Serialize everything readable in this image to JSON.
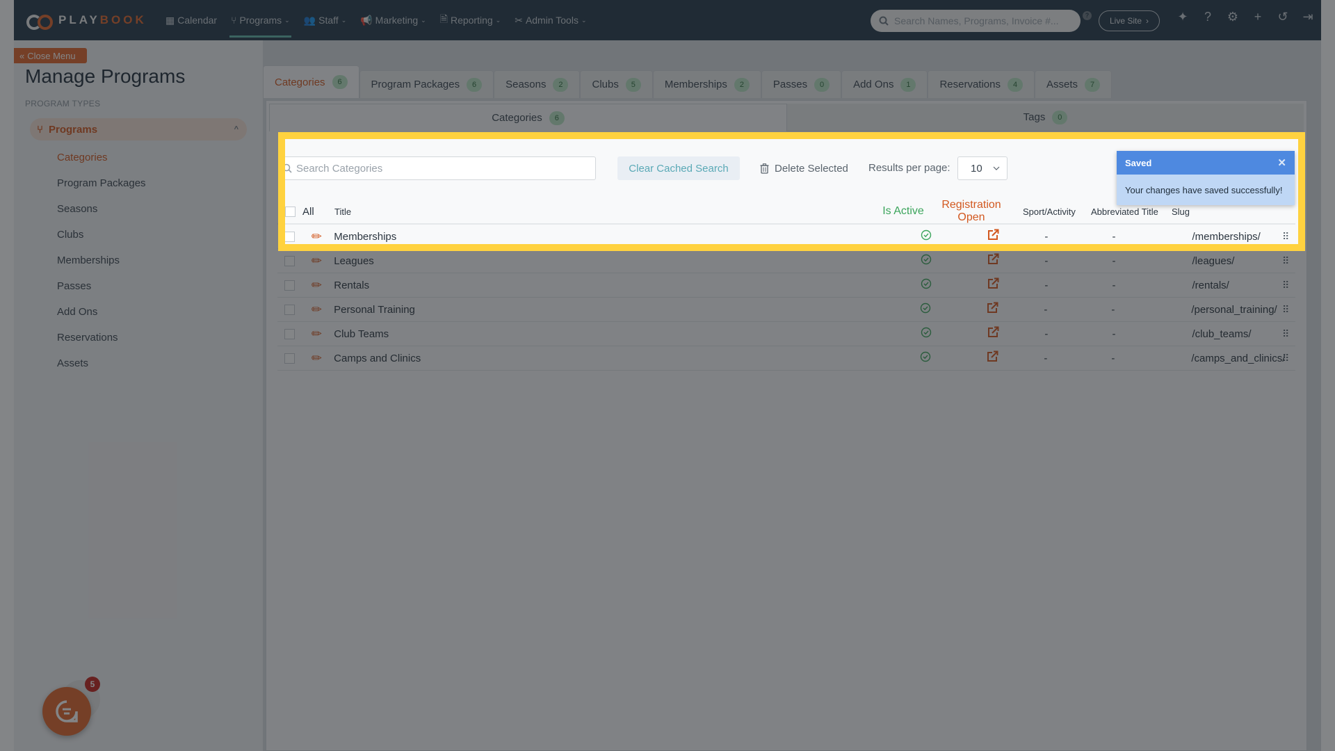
{
  "nav": {
    "logo_left": "PLAY",
    "logo_right": "BOOK",
    "items": [
      {
        "label": "Calendar",
        "icon": "calendar-icon",
        "glyph": "▦",
        "caret": ""
      },
      {
        "label": "Programs",
        "icon": "branch-icon",
        "glyph": "⑂",
        "caret": "⌄"
      },
      {
        "label": "Staff",
        "icon": "users-icon",
        "glyph": "👥",
        "caret": "⌄"
      },
      {
        "label": "Marketing",
        "icon": "megaphone-icon",
        "glyph": "📢",
        "caret": "⌄"
      },
      {
        "label": "Reporting",
        "icon": "document-icon",
        "glyph": "🗎",
        "caret": "⌄"
      },
      {
        "label": "Admin Tools",
        "icon": "tools-icon",
        "glyph": "✂",
        "caret": "⌄"
      }
    ],
    "search_placeholder": "Search Names, Programs, Invoice #...",
    "help_small": "?",
    "live_site": "Live Site",
    "live_site_arrow": "›",
    "icons": {
      "announce": "✦",
      "help": "?",
      "settings": "⚙",
      "add_user": "+",
      "history": "↺",
      "logout": "⇥"
    }
  },
  "sidebar": {
    "close_menu": "Close Menu",
    "close_icon": "«",
    "title": "Manage Programs",
    "section": "PROGRAM TYPES",
    "group": {
      "label": "Programs",
      "icon": "⑂",
      "chevron": "^"
    },
    "items": [
      "Categories",
      "Program Packages",
      "Seasons",
      "Clubs",
      "Memberships",
      "Passes",
      "Add Ons",
      "Reservations",
      "Assets"
    ],
    "active_index": 0
  },
  "tabs": [
    {
      "label": "Categories",
      "count": "6"
    },
    {
      "label": "Program Packages",
      "count": "6"
    },
    {
      "label": "Seasons",
      "count": "2"
    },
    {
      "label": "Clubs",
      "count": "5"
    },
    {
      "label": "Memberships",
      "count": "2"
    },
    {
      "label": "Passes",
      "count": "0"
    },
    {
      "label": "Add Ons",
      "count": "1"
    },
    {
      "label": "Reservations",
      "count": "4"
    },
    {
      "label": "Assets",
      "count": "7"
    }
  ],
  "subtabs": [
    {
      "label": "Categories",
      "count": "6"
    },
    {
      "label": "Tags",
      "count": "0"
    }
  ],
  "toolbar": {
    "search_placeholder": "Search Categories",
    "clear_cached": "Clear Cached Search",
    "delete_selected": "Delete Selected",
    "results_per_page_label": "Results per page:",
    "results_per_page_value": "10"
  },
  "table": {
    "headers": {
      "all": "All",
      "title": "Title",
      "is_active": "Is Active",
      "registration_open": "Registration Open",
      "sport": "Sport/Activity",
      "abbr": "Abbreviated Title",
      "slug": "Slug"
    },
    "rows": [
      {
        "title": "Memberships",
        "active": "✓",
        "sport": "-",
        "abbr": "-",
        "slug": "/memberships/"
      },
      {
        "title": "Leagues",
        "active": "✓",
        "sport": "-",
        "abbr": "-",
        "slug": "/leagues/"
      },
      {
        "title": "Rentals",
        "active": "✓",
        "sport": "-",
        "abbr": "-",
        "slug": "/rentals/"
      },
      {
        "title": "Personal Training",
        "active": "✓",
        "sport": "-",
        "abbr": "-",
        "slug": "/personal_training/"
      },
      {
        "title": "Club Teams",
        "active": "✓",
        "sport": "-",
        "abbr": "-",
        "slug": "/club_teams/"
      },
      {
        "title": "Camps and Clinics",
        "active": "✓",
        "sport": "-",
        "abbr": "-",
        "slug": "/camps_and_clinics/"
      }
    ]
  },
  "toast": {
    "title": "Saved",
    "message": "Your changes have saved successfully!",
    "close": "✕"
  },
  "chat": {
    "badge": "5"
  },
  "colors": {
    "brand": "#e0652a",
    "nav_bg": "#24394a",
    "highlight": "#ffd23f",
    "toast_header": "#4e89e0",
    "badge_green": "#b9e3c4"
  }
}
